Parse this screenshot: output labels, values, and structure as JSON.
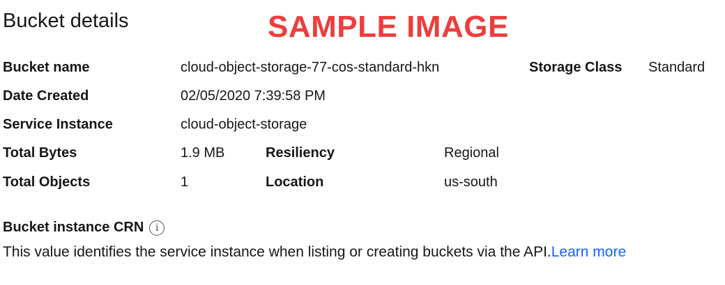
{
  "page": {
    "title": "Bucket details",
    "watermark": "SAMPLE IMAGE"
  },
  "details": {
    "bucket_name": {
      "label": "Bucket name",
      "value": "cloud-object-storage-77-cos-standard-hkn"
    },
    "storage_class": {
      "label": "Storage Class",
      "value": "Standard"
    },
    "date_created": {
      "label": "Date Created",
      "value": "02/05/2020 7:39:58 PM"
    },
    "service_instance": {
      "label": "Service Instance",
      "value": "cloud-object-storage"
    },
    "total_bytes": {
      "label": "Total Bytes",
      "value": "1.9 MB"
    },
    "resiliency": {
      "label": "Resiliency",
      "value": "Regional"
    },
    "total_objects": {
      "label": "Total Objects",
      "value": "1"
    },
    "location": {
      "label": "Location",
      "value": "us-south"
    }
  },
  "crn": {
    "title": "Bucket instance CRN",
    "info_icon": "info-icon",
    "description": "This value identifies the service instance when listing or creating buckets via the API.",
    "learn_more": "Learn more"
  },
  "colors": {
    "text": "#161616",
    "link": "#0f62fe",
    "watermark": "#ee3d3d"
  }
}
